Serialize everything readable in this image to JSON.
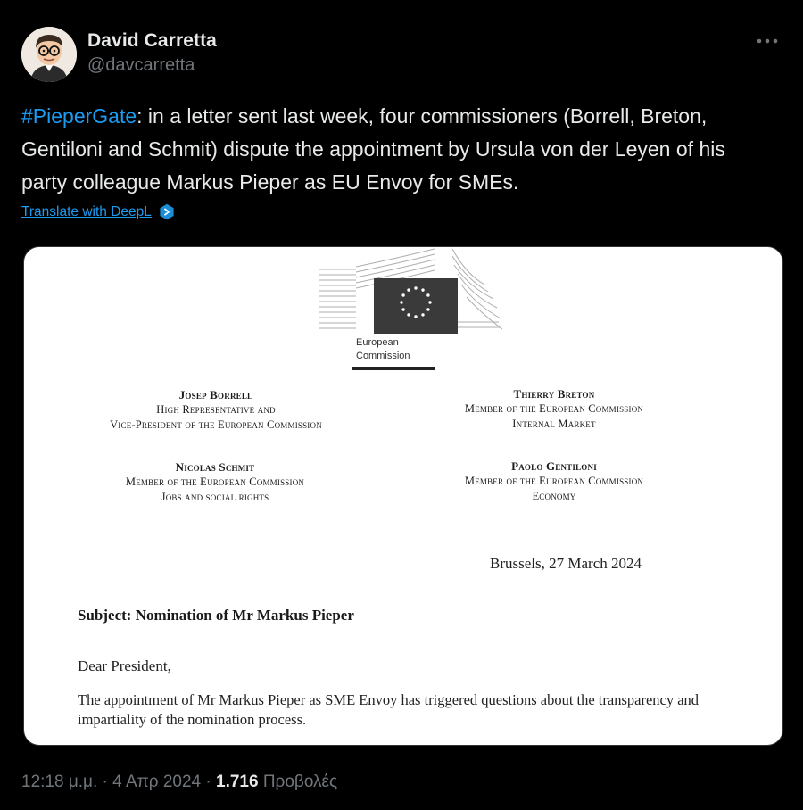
{
  "author": {
    "display_name": "David Carretta",
    "handle": "@davcarretta",
    "avatar_icon": "cartoon-portrait-avatar"
  },
  "more_icon": "more-options-icon",
  "tweet": {
    "hashtag": "#PieperGate",
    "text": ": in a letter sent last week, four commissioners (Borrell, Breton, Gentiloni and Schmit) dispute the appointment by Ursula von der Leyen of his party colleague Markus Pieper as EU Envoy for SMEs.",
    "translate_label": "Translate with DeepL",
    "translate_icon": "deepl-icon"
  },
  "letter": {
    "logo_icon": "european-commission-logo",
    "logo_text_1": "European",
    "logo_text_2": "Commission",
    "signatories": [
      {
        "name": "Josep Borrell",
        "lines": [
          "High Representative and",
          "Vice-President of the European Commission"
        ]
      },
      {
        "name": "Thierry Breton",
        "lines": [
          "Member of the European Commission",
          "Internal Market"
        ]
      },
      {
        "name": "Nicolas Schmit",
        "lines": [
          "Member of the European Commission",
          "Jobs and social rights"
        ]
      },
      {
        "name": "Paolo Gentiloni",
        "lines": [
          "Member of the European Commission",
          "Economy"
        ]
      }
    ],
    "date": "Brussels, 27 March 2024",
    "subject": "Subject: Nomination of Mr Markus Pieper",
    "salutation": "Dear President,",
    "body": "The appointment of Mr Markus Pieper as SME Envoy has triggered questions about the transparency and impartiality of the nomination process."
  },
  "meta": {
    "time": "12:18 μ.μ.",
    "separator": " · ",
    "date": "4 Απρ 2024",
    "views_count": "1.716",
    "views_label": " Προβολές"
  },
  "colors": {
    "background": "#000000",
    "text": "#e7e9ea",
    "secondary": "#71767b",
    "accent": "#1d9bf0"
  }
}
